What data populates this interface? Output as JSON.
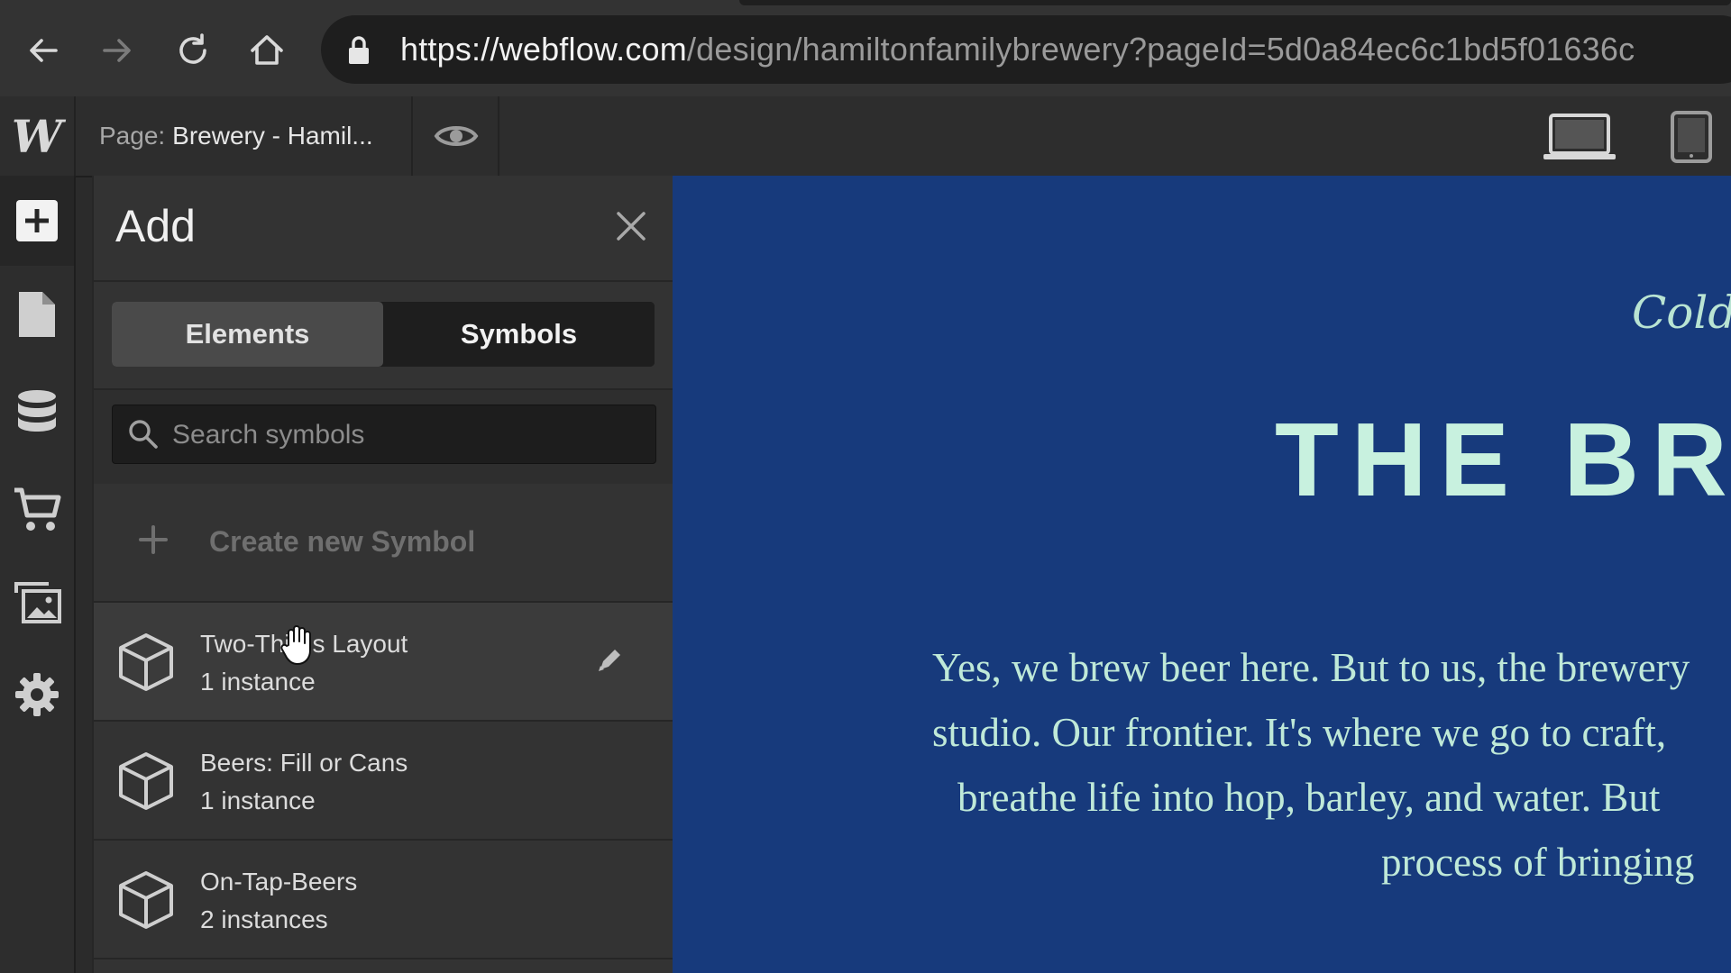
{
  "browser": {
    "url_host": "https://webflow.com",
    "url_path": "/design/hamiltonfamilybrewery?pageId=5d0a84ec6c1bd5f01636c"
  },
  "toolbar": {
    "page_label": "Page:",
    "page_name": "Brewery - Hamil..."
  },
  "panel": {
    "title": "Add",
    "tabs": [
      {
        "label": "Elements",
        "active": false
      },
      {
        "label": "Symbols",
        "active": true
      }
    ],
    "search_placeholder": "Search symbols",
    "create_label": "Create new Symbol",
    "symbols": [
      {
        "name": "Two-Thirds Layout",
        "count": "1 instance"
      },
      {
        "name": "Beers: Fill or Cans",
        "count": "1 instance"
      },
      {
        "name": "On-Tap-Beers",
        "count": "2 instances"
      }
    ]
  },
  "canvas": {
    "tagline": "Cold B",
    "headline": "THE BR",
    "body_lines": [
      "Yes, we brew beer here. But to us, the brewery",
      "studio. Our frontier. It's where we go to craft,",
      "breathe life into hop, barley, and water. But",
      "process of bringing"
    ],
    "colors": {
      "background": "#173a7c",
      "text": "#c8f1df"
    }
  }
}
